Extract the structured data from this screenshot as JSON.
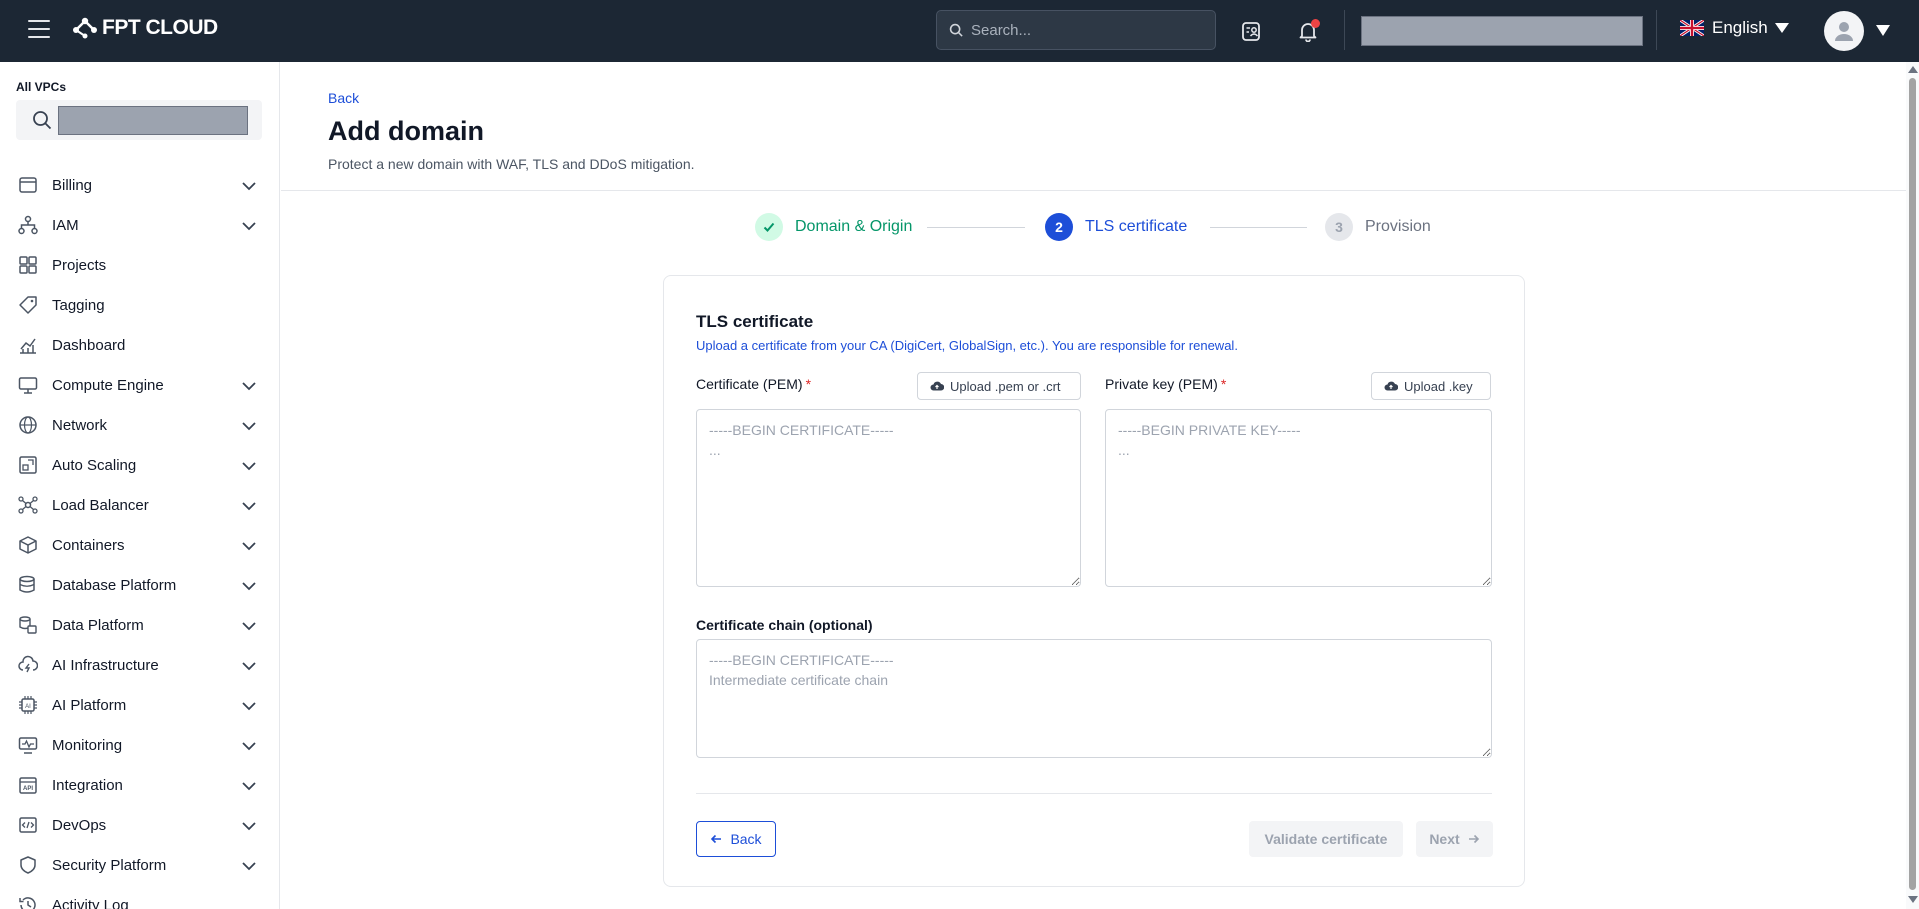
{
  "topbar": {
    "brand": "FPT CLOUD",
    "search_placeholder": "Search...",
    "language": "English"
  },
  "sidebar": {
    "vpc_label": "All VPCs",
    "items": [
      {
        "label": "Billing",
        "icon": "billing-icon",
        "expandable": true
      },
      {
        "label": "IAM",
        "icon": "iam-icon",
        "expandable": true
      },
      {
        "label": "Projects",
        "icon": "projects-icon",
        "expandable": false
      },
      {
        "label": "Tagging",
        "icon": "tag-icon",
        "expandable": false
      },
      {
        "label": "Dashboard",
        "icon": "dashboard-icon",
        "expandable": false
      },
      {
        "label": "Compute Engine",
        "icon": "monitor-icon",
        "expandable": true
      },
      {
        "label": "Network",
        "icon": "globe-icon",
        "expandable": true
      },
      {
        "label": "Auto Scaling",
        "icon": "auto-scaling-icon",
        "expandable": true
      },
      {
        "label": "Load Balancer",
        "icon": "load-balancer-icon",
        "expandable": true
      },
      {
        "label": "Containers",
        "icon": "cube-icon",
        "expandable": true
      },
      {
        "label": "Database Platform",
        "icon": "database-icon",
        "expandable": true
      },
      {
        "label": "Data Platform",
        "icon": "data-platform-icon",
        "expandable": true
      },
      {
        "label": "AI Infrastructure",
        "icon": "ai-infrastructure-icon",
        "expandable": true
      },
      {
        "label": "AI Platform",
        "icon": "ai-chip-icon",
        "expandable": true
      },
      {
        "label": "Monitoring",
        "icon": "monitoring-icon",
        "expandable": true
      },
      {
        "label": "Integration",
        "icon": "api-icon",
        "expandable": true
      },
      {
        "label": "DevOps",
        "icon": "code-icon",
        "expandable": true
      },
      {
        "label": "Security Platform",
        "icon": "shield-icon",
        "expandable": true
      },
      {
        "label": "Activity Log",
        "icon": "history-icon",
        "expandable": false
      }
    ]
  },
  "header": {
    "back_label": "Back",
    "title": "Add domain",
    "subtitle": "Protect a new domain with WAF, TLS and DDoS mitigation."
  },
  "stepper": {
    "steps": [
      {
        "number": "1",
        "label": "Domain & Origin",
        "status": "completed"
      },
      {
        "number": "2",
        "label": "TLS certificate",
        "status": "active"
      },
      {
        "number": "3",
        "label": "Provision",
        "status": "pending"
      }
    ]
  },
  "form": {
    "title": "TLS certificate",
    "description": "Upload a certificate from your CA (DigiCert, GlobalSign, etc.). You are responsible for renewal.",
    "certificate": {
      "label": "Certificate (PEM)",
      "required_mark": "*",
      "upload_label": "Upload .pem or .crt",
      "placeholder": "-----BEGIN CERTIFICATE-----\n...",
      "value": ""
    },
    "private_key": {
      "label": "Private key (PEM)",
      "required_mark": "*",
      "upload_label": "Upload .key",
      "placeholder": "-----BEGIN PRIVATE KEY-----\n...",
      "value": ""
    },
    "chain": {
      "label": "Certificate chain (optional)",
      "placeholder": "-----BEGIN CERTIFICATE-----\nIntermediate certificate chain",
      "value": ""
    },
    "back_button": "Back",
    "validate_button": "Validate certificate",
    "next_button": "Next"
  },
  "colors": {
    "topbar_bg": "#1c2734",
    "accent": "#1d4ed8",
    "step_complete": "#059669",
    "required": "#dc2626",
    "notification_dot": "#ef4444"
  }
}
